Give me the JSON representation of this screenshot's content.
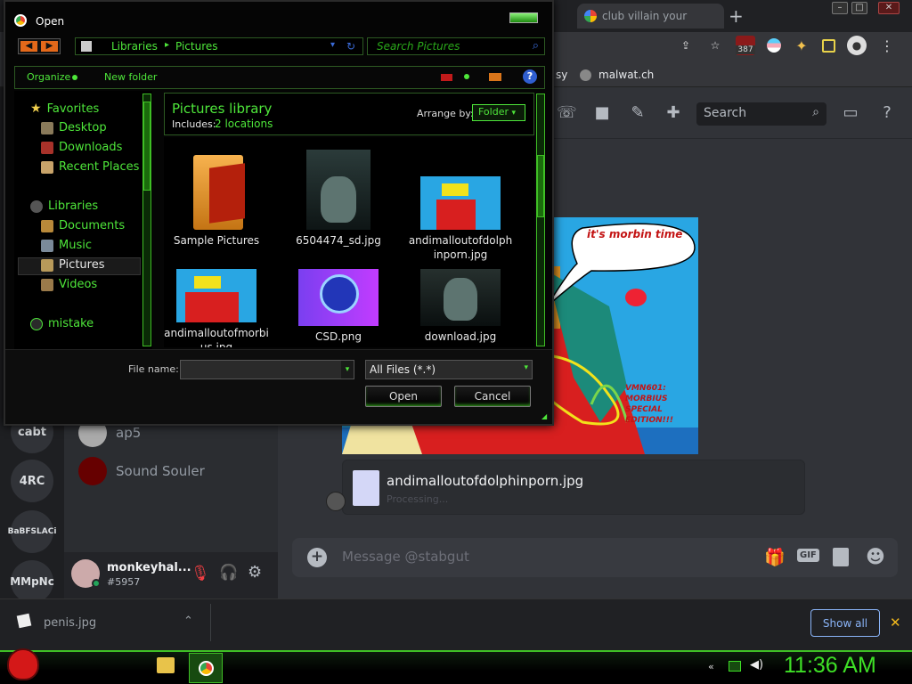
{
  "chrome": {
    "tab_title": "club villain your",
    "new_tab": "+",
    "ext_badge": "387",
    "bookmarks": [
      "sy",
      "malwat.ch"
    ]
  },
  "discord": {
    "servers": [
      "cabt",
      "4RC",
      "BaBFSLACi",
      "MMpNc"
    ],
    "dms": [
      "ap5",
      "Sound Souler"
    ],
    "user": {
      "name": "monkeyhal...",
      "tag": "#5957"
    },
    "search_placeholder": "Search",
    "meme_bubble": "it's morbin time",
    "meme_caption": "VMN601:\nMORBIUS\nSPECIAL\nEDITION!!!",
    "file_name": "andimalloutofdolphinporn.jpg",
    "file_status": "Processing...",
    "message_placeholder": "Message @stabgut",
    "gif_label": "GIF"
  },
  "download_bar": {
    "file": "penis.jpg",
    "show_all": "Show all",
    "close": "✕"
  },
  "taskbar": {
    "clock": "11:36 AM"
  },
  "dialog": {
    "title": "Open",
    "breadcrumb": [
      "Libraries",
      "Pictures"
    ],
    "search_placeholder": "Search Pictures",
    "organize": "Organize",
    "new_folder": "New folder",
    "help": "?",
    "library_title": "Pictures library",
    "includes_label": "Includes:",
    "includes_value": "2 locations",
    "arrange_label": "Arrange by:",
    "arrange_value": "Folder",
    "nav": {
      "favorites": "Favorites",
      "desktop": "Desktop",
      "downloads": "Downloads",
      "recent": "Recent Places",
      "libraries": "Libraries",
      "documents": "Documents",
      "music": "Music",
      "pictures": "Pictures",
      "videos": "Videos",
      "mistake": "mistake"
    },
    "files": [
      {
        "name": "Sample Pictures"
      },
      {
        "name": "6504474_sd.jpg"
      },
      {
        "name": "andimalloutofdolphinporn.jpg"
      },
      {
        "name": "andimalloutofmorbius.jpg"
      },
      {
        "name": "CSD.png"
      },
      {
        "name": "download.jpg"
      }
    ],
    "filename_label": "File name:",
    "filename_value": "",
    "filter_value": "All Files (*.*)",
    "open_button": "Open",
    "cancel_button": "Cancel"
  }
}
